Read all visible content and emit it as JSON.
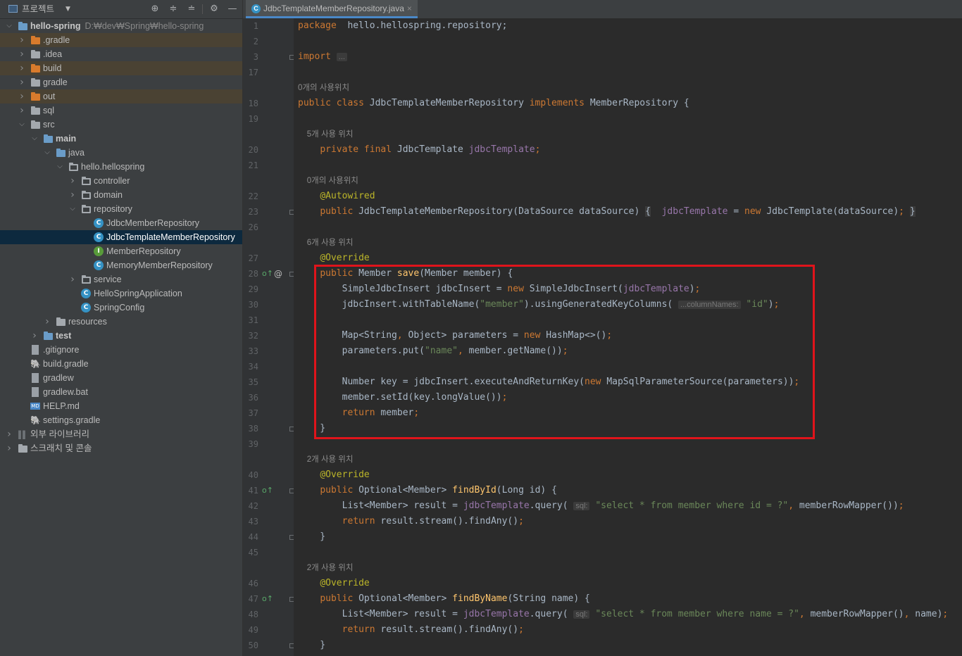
{
  "project_panel": {
    "title": "프로젝트",
    "icons": [
      "target-icon",
      "expand-all-icon",
      "collapse-all-icon",
      "gear-icon",
      "minimize-icon"
    ]
  },
  "tree": [
    {
      "label": "hello-spring",
      "path": "D:₩dev₩Spring₩hello-spring",
      "bold": true,
      "level": 0,
      "icon": "module-folder-icon",
      "chevron": "down"
    },
    {
      "label": ".gradle",
      "level": 1,
      "icon": "folder-orange-icon",
      "chevron": "right",
      "hl": true
    },
    {
      "label": ".idea",
      "level": 1,
      "icon": "folder-icon",
      "chevron": "right"
    },
    {
      "label": "build",
      "level": 1,
      "icon": "folder-orange-icon",
      "chevron": "right",
      "hl": true
    },
    {
      "label": "gradle",
      "level": 1,
      "icon": "folder-icon",
      "chevron": "right"
    },
    {
      "label": "out",
      "level": 1,
      "icon": "folder-orange-icon",
      "chevron": "right",
      "hl": true
    },
    {
      "label": "sql",
      "level": 1,
      "icon": "folder-icon",
      "chevron": "right"
    },
    {
      "label": "src",
      "level": 1,
      "icon": "folder-icon",
      "chevron": "down"
    },
    {
      "label": "main",
      "level": 2,
      "icon": "source-folder-icon",
      "chevron": "down",
      "bold": true
    },
    {
      "label": "java",
      "level": 3,
      "icon": "folder-blue-icon",
      "chevron": "down"
    },
    {
      "label": "hello.hellospring",
      "level": 4,
      "icon": "package-icon",
      "chevron": "down"
    },
    {
      "label": "controller",
      "level": 5,
      "icon": "package-icon",
      "chevron": "right"
    },
    {
      "label": "domain",
      "level": 5,
      "icon": "package-icon",
      "chevron": "right"
    },
    {
      "label": "repository",
      "level": 5,
      "icon": "package-icon",
      "chevron": "down"
    },
    {
      "label": "JdbcMemberRepository",
      "level": 6,
      "icon": "class-icon"
    },
    {
      "label": "JdbcTemplateMemberRepository",
      "level": 6,
      "icon": "class-icon",
      "selected": true
    },
    {
      "label": "MemberRepository",
      "level": 6,
      "icon": "interface-icon"
    },
    {
      "label": "MemoryMemberRepository",
      "level": 6,
      "icon": "class-icon"
    },
    {
      "label": "service",
      "level": 5,
      "icon": "package-icon",
      "chevron": "right"
    },
    {
      "label": "HelloSpringApplication",
      "level": 5,
      "icon": "spring-class-icon"
    },
    {
      "label": "SpringConfig",
      "level": 5,
      "icon": "class-icon"
    },
    {
      "label": "resources",
      "level": 3,
      "icon": "resources-folder-icon",
      "chevron": "right"
    },
    {
      "label": "test",
      "level": 2,
      "icon": "test-folder-icon",
      "chevron": "right",
      "bold": true
    },
    {
      "label": ".gitignore",
      "level": 1,
      "icon": "gitignore-icon"
    },
    {
      "label": "build.gradle",
      "level": 1,
      "icon": "gradle-icon"
    },
    {
      "label": "gradlew",
      "level": 1,
      "icon": "script-icon"
    },
    {
      "label": "gradlew.bat",
      "level": 1,
      "icon": "bat-file-icon"
    },
    {
      "label": "HELP.md",
      "level": 1,
      "icon": "markdown-icon"
    },
    {
      "label": "settings.gradle",
      "level": 1,
      "icon": "gradle-icon"
    },
    {
      "label": "외부 라이브러리",
      "level": 0,
      "icon": "library-icon",
      "chevron": "right"
    },
    {
      "label": "스크래치 및 콘솔",
      "level": 0,
      "icon": "scratch-icon",
      "chevron": "right"
    }
  ],
  "editor": {
    "tab_label": "JdbcTemplateMemberRepository.java",
    "tab_close": "×"
  },
  "code_lines": [
    {
      "n": "1",
      "segs": [
        [
          "kw",
          "package"
        ],
        [
          "",
          "  hello.hellospring.repository;"
        ]
      ]
    },
    {
      "n": "2",
      "segs": []
    },
    {
      "n": "3",
      "segs": [
        [
          "kw",
          "import"
        ],
        [
          "",
          " "
        ],
        [
          "ph",
          "..."
        ]
      ]
    },
    {
      "n": "17",
      "segs": []
    },
    {
      "hint": "0개의 사용위치"
    },
    {
      "n": "18",
      "segs": [
        [
          "kw",
          "public class "
        ],
        [
          "",
          "JdbcTemplateMemberRepository "
        ],
        [
          "kw",
          "implements "
        ],
        [
          "",
          "MemberRepository {"
        ]
      ]
    },
    {
      "n": "19",
      "segs": []
    },
    {
      "hint": "    5개 사용 위치"
    },
    {
      "n": "20",
      "segs": [
        [
          "",
          "    "
        ],
        [
          "kw",
          "private final "
        ],
        [
          "",
          "JdbcTemplate "
        ],
        [
          "fld",
          "jdbcTemplate"
        ],
        [
          "kw",
          ";"
        ]
      ]
    },
    {
      "n": "21",
      "segs": []
    },
    {
      "hint": "    0개의 사용위치"
    },
    {
      "n": "22",
      "segs": [
        [
          "",
          "    "
        ],
        [
          "ann",
          "@Autowired"
        ]
      ]
    },
    {
      "n": "23",
      "segs": [
        [
          "",
          "    "
        ],
        [
          "kw",
          "public "
        ],
        [
          "",
          "JdbcTemplateMemberRepository(DataSource dataSource) "
        ],
        [
          "brace",
          "{"
        ],
        [
          "",
          "  "
        ],
        [
          "fld",
          "jdbcTemplate"
        ],
        [
          "",
          " = "
        ],
        [
          "kw",
          "new "
        ],
        [
          "",
          "JdbcTemplate(dataSource)"
        ],
        [
          "kw",
          ";"
        ],
        [
          "",
          " "
        ],
        [
          "brace",
          "}"
        ]
      ]
    },
    {
      "n": "26",
      "segs": []
    },
    {
      "hint": "    6개 사용 위치"
    },
    {
      "n": "27",
      "segs": [
        [
          "",
          "    "
        ],
        [
          "ann",
          "@Override"
        ]
      ]
    },
    {
      "n": "28",
      "segs": [
        [
          "",
          "    "
        ],
        [
          "kw",
          "public "
        ],
        [
          "",
          "Member "
        ],
        [
          "fn",
          "save"
        ],
        [
          "",
          "(Member member) {"
        ]
      ]
    },
    {
      "n": "29",
      "segs": [
        [
          "",
          "        SimpleJdbcInsert jdbcInsert = "
        ],
        [
          "kw",
          "new "
        ],
        [
          "",
          "SimpleJdbcInsert("
        ],
        [
          "fld",
          "jdbcTemplate"
        ],
        [
          "",
          ")"
        ],
        [
          "kw",
          ";"
        ]
      ]
    },
    {
      "n": "30",
      "segs": [
        [
          "",
          "        jdbcInsert.withTableName("
        ],
        [
          "str",
          "\"member\""
        ],
        [
          "",
          ").usingGeneratedKeyColumns( "
        ],
        [
          "ph",
          "...columnNames:"
        ],
        [
          "",
          " "
        ],
        [
          "str",
          "\"id\""
        ],
        [
          "",
          ")"
        ],
        [
          "kw",
          ";"
        ]
      ]
    },
    {
      "n": "31",
      "segs": []
    },
    {
      "n": "32",
      "segs": [
        [
          "",
          "        Map<String"
        ],
        [
          "kw",
          ", "
        ],
        [
          "",
          "Object> parameters = "
        ],
        [
          "kw",
          "new "
        ],
        [
          "",
          "HashMap<>()"
        ],
        [
          "kw",
          ";"
        ]
      ]
    },
    {
      "n": "33",
      "segs": [
        [
          "",
          "        parameters.put("
        ],
        [
          "str",
          "\"name\""
        ],
        [
          "kw",
          ", "
        ],
        [
          "",
          "member.getName())"
        ],
        [
          "kw",
          ";"
        ]
      ]
    },
    {
      "n": "34",
      "segs": []
    },
    {
      "n": "35",
      "segs": [
        [
          "",
          "        Number key = jdbcInsert.executeAndReturnKey("
        ],
        [
          "kw",
          "new "
        ],
        [
          "",
          "MapSqlParameterSource(parameters))"
        ],
        [
          "kw",
          ";"
        ]
      ]
    },
    {
      "n": "36",
      "segs": [
        [
          "",
          "        member.setId(key.longValue())"
        ],
        [
          "kw",
          ";"
        ]
      ]
    },
    {
      "n": "37",
      "segs": [
        [
          "",
          "        "
        ],
        [
          "kw",
          "return "
        ],
        [
          "",
          "member"
        ],
        [
          "kw",
          ";"
        ]
      ]
    },
    {
      "n": "38",
      "segs": [
        [
          "",
          "    }"
        ]
      ]
    },
    {
      "n": "39",
      "segs": []
    },
    {
      "hint": "    2개 사용 위치"
    },
    {
      "n": "40",
      "segs": [
        [
          "",
          "    "
        ],
        [
          "ann",
          "@Override"
        ]
      ]
    },
    {
      "n": "41",
      "segs": [
        [
          "",
          "    "
        ],
        [
          "kw",
          "public "
        ],
        [
          "",
          "Optional<Member> "
        ],
        [
          "fn",
          "findById"
        ],
        [
          "",
          "(Long id) {"
        ]
      ]
    },
    {
      "n": "42",
      "segs": [
        [
          "",
          "        List<Member> result = "
        ],
        [
          "fld",
          "jdbcTemplate"
        ],
        [
          "",
          ".query( "
        ],
        [
          "ph",
          "sql:"
        ],
        [
          "",
          " "
        ],
        [
          "str",
          "\"select * from member where id = ?\""
        ],
        [
          "kw",
          ", "
        ],
        [
          "",
          "memberRowMapper())"
        ],
        [
          "kw",
          ";"
        ]
      ]
    },
    {
      "n": "43",
      "segs": [
        [
          "",
          "        "
        ],
        [
          "kw",
          "return "
        ],
        [
          "",
          "result.stream().findAny()"
        ],
        [
          "kw",
          ";"
        ]
      ]
    },
    {
      "n": "44",
      "segs": [
        [
          "",
          "    }"
        ]
      ]
    },
    {
      "n": "45",
      "segs": []
    },
    {
      "hint": "    2개 사용 위치"
    },
    {
      "n": "46",
      "segs": [
        [
          "",
          "    "
        ],
        [
          "ann",
          "@Override"
        ]
      ]
    },
    {
      "n": "47",
      "segs": [
        [
          "",
          "    "
        ],
        [
          "kw",
          "public "
        ],
        [
          "",
          "Optional<Member> "
        ],
        [
          "fn",
          "findByName"
        ],
        [
          "",
          "(String name) {"
        ]
      ]
    },
    {
      "n": "48",
      "segs": [
        [
          "",
          "        List<Member> result = "
        ],
        [
          "fld",
          "jdbcTemplate"
        ],
        [
          "",
          ".query( "
        ],
        [
          "ph",
          "sql:"
        ],
        [
          "",
          " "
        ],
        [
          "str",
          "\"select * from member where name = ?\""
        ],
        [
          "kw",
          ", "
        ],
        [
          "",
          "memberRowMapper()"
        ],
        [
          "kw",
          ", "
        ],
        [
          "",
          "name)"
        ],
        [
          "kw",
          ";"
        ]
      ]
    },
    {
      "n": "49",
      "segs": [
        [
          "",
          "        "
        ],
        [
          "kw",
          "return "
        ],
        [
          "",
          "result.stream().findAny()"
        ],
        [
          "kw",
          ";"
        ]
      ]
    },
    {
      "n": "50",
      "segs": [
        [
          "",
          "    }"
        ]
      ]
    }
  ],
  "colors": {
    "keyword": "#cc7832",
    "string": "#6a8759",
    "field": "#9876aa",
    "annotation": "#bbb529",
    "method": "#ffc66d",
    "highlight_box": "#e0141b",
    "selection": "#0d293e"
  }
}
